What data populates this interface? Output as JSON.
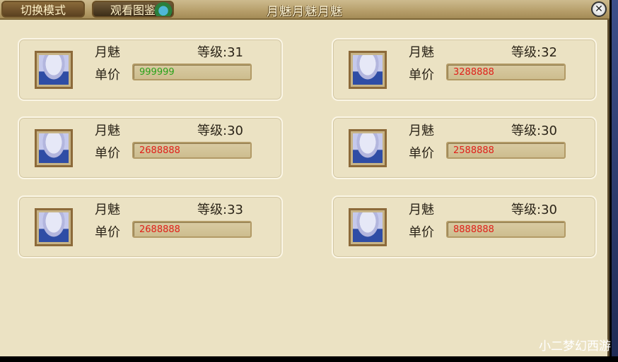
{
  "window": {
    "title": "月魅月魅月魅",
    "mode_button": "切换模式",
    "atlas_button": "观看图鉴",
    "close_label": "✕"
  },
  "listings": [
    {
      "name": "月魅",
      "level": "等级:31",
      "price_label": "单价",
      "price": "999999",
      "price_color": "#2aa21a"
    },
    {
      "name": "月魅",
      "level": "等级:32",
      "price_label": "单价",
      "price": "3288888",
      "price_color": "#e0201a"
    },
    {
      "name": "月魅",
      "level": "等级:30",
      "price_label": "单价",
      "price": "2688888",
      "price_color": "#e0201a"
    },
    {
      "name": "月魅",
      "level": "等级:30",
      "price_label": "单价",
      "price": "2588888",
      "price_color": "#e0201a"
    },
    {
      "name": "月魅",
      "level": "等级:33",
      "price_label": "单价",
      "price": "2688888",
      "price_color": "#e0201a"
    },
    {
      "name": "月魅",
      "level": "等级:30",
      "price_label": "单价",
      "price": "8888888",
      "price_color": "#e0201a"
    }
  ],
  "watermark": "小二梦幻西游"
}
